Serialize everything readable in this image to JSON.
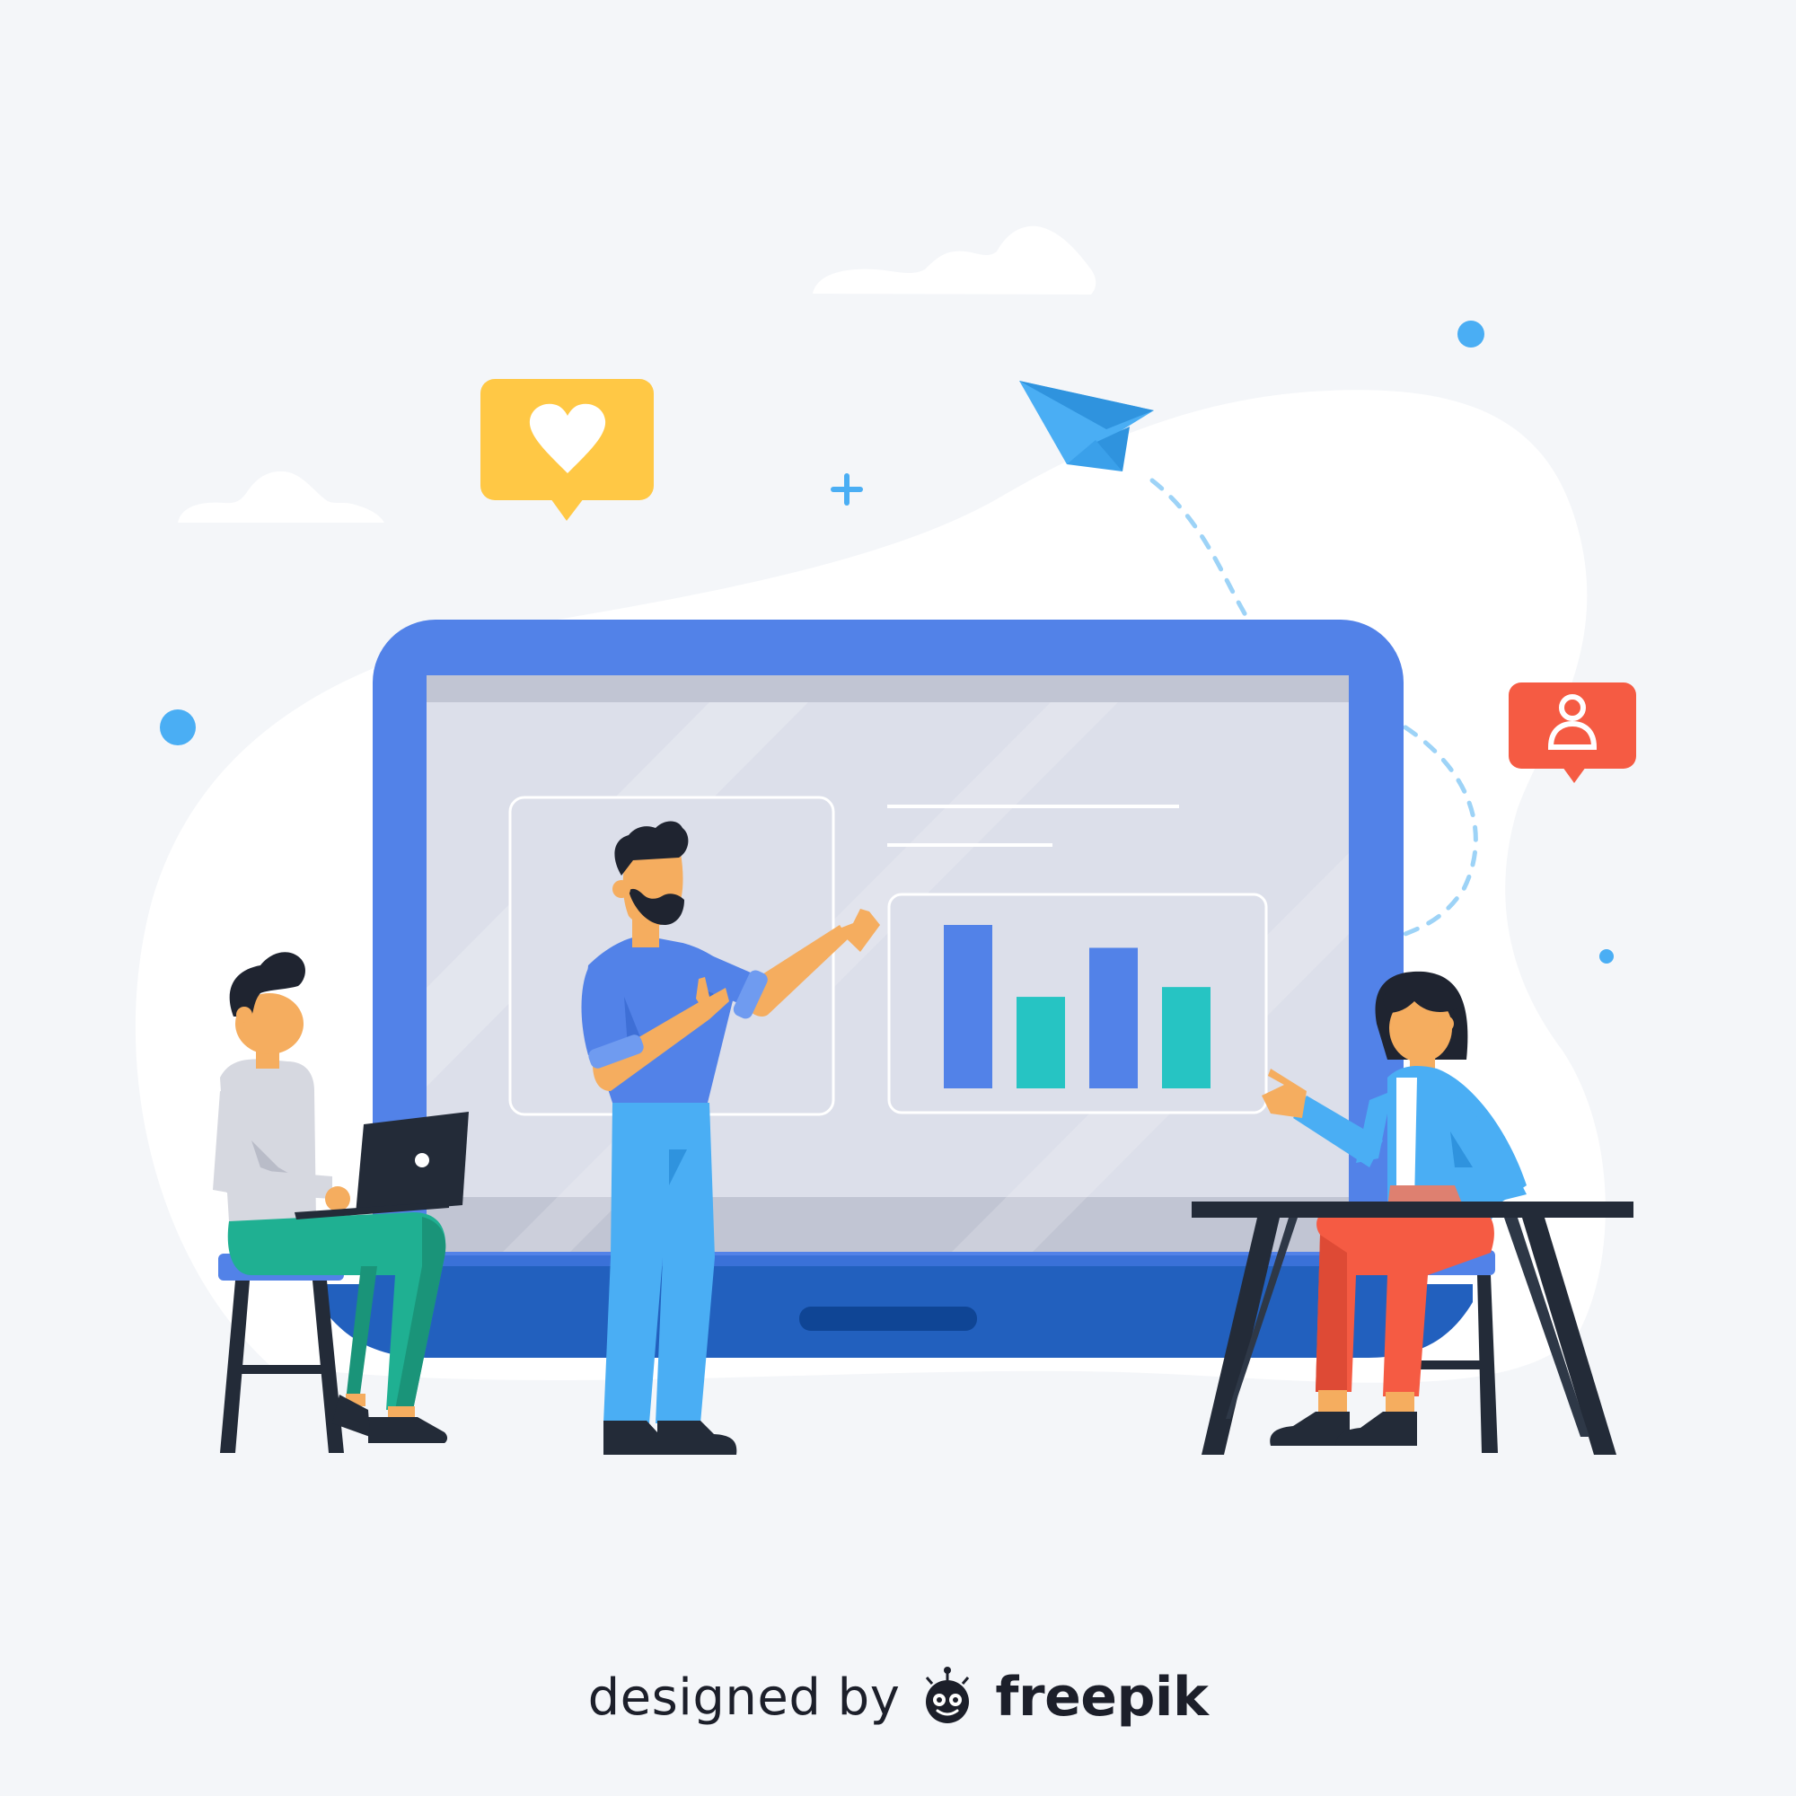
{
  "credit": {
    "prefix": "designed by",
    "brand": "freepik",
    "logo_icon": "freepik-logo-icon"
  },
  "icons": {
    "heart_bubble": "heart-icon",
    "user_bubble": "user-icon",
    "paper_plane": "paper-plane-icon"
  },
  "colors": {
    "background": "#f4f6f9",
    "blob": "#ffffff",
    "laptop_frame": "#5282e8",
    "screen": "#dcdfea",
    "bar_blue": "#5282e8",
    "bar_teal": "#26c4c3",
    "heart_bubble": "#ffc845",
    "user_bubble": "#f55b43",
    "plane": "#4aaef4",
    "skin": "#f5ad5f",
    "hair": "#1f2430"
  },
  "screen_chart": {
    "bars": [
      1.0,
      0.56,
      0.86,
      0.62
    ],
    "bar_colors": [
      "#5282e8",
      "#26c4c3",
      "#5282e8",
      "#26c4c3"
    ]
  }
}
